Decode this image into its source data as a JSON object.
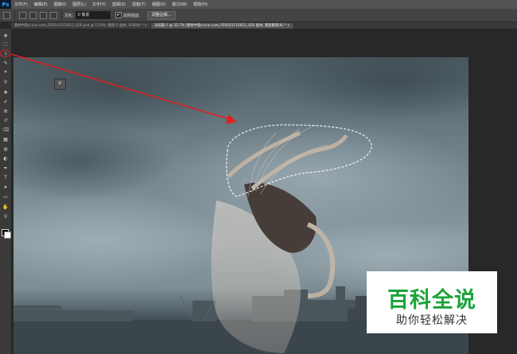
{
  "app": {
    "logo": "Ps"
  },
  "menu": [
    "文件(F)",
    "编辑(E)",
    "图像(I)",
    "图层(L)",
    "文字(Y)",
    "选择(S)",
    "滤镜(T)",
    "视图(V)",
    "窗口(W)",
    "帮助(H)"
  ],
  "options": {
    "feather_label": "羽化:",
    "feather_value": "0 像素",
    "antialias_label": "消除锯齿",
    "antialias_checked": "✔",
    "refine_edge_label": "调整边缘..."
  },
  "tabs": [
    {
      "label": "素材中国sccnn.com_P20161110012_026.psd @ 15.6% (图层 0 副本, RGB/8) *  ×"
    },
    {
      "label": "未标题-1 @ 32.7% (素材中国sccnn.com_P20161110012_026 副本, 图层蒙版/8) *  ×"
    }
  ],
  "toolbar": {
    "tools": [
      "move-tool",
      "marquee-tool",
      "lasso-tool",
      "quick-select-tool",
      "crop-tool",
      "eyedropper-tool",
      "healing-brush-tool",
      "brush-tool",
      "clone-stamp-tool",
      "history-brush-tool",
      "eraser-tool",
      "gradient-tool",
      "blur-tool",
      "dodge-tool",
      "pen-tool",
      "type-tool",
      "path-select-tool",
      "shape-tool",
      "hand-tool",
      "zoom-tool"
    ],
    "glyphs": [
      "✥",
      "⬚",
      "ↄ",
      "✎",
      "⌗",
      "⚲",
      "✚",
      "✐",
      "⚒",
      "↺",
      "⌫",
      "▦",
      "◍",
      "◐",
      "✒",
      "T",
      "➤",
      "▭",
      "✋",
      "⚲"
    ],
    "foreground_color": "#000000",
    "background_color": "#ffffff"
  },
  "canvas": {
    "tooltip_glyph": "P",
    "annotation_color": "#e02020"
  },
  "watermark": {
    "title": "百科全说",
    "subtitle": "助你轻松解决",
    "title_color": "#1aa33a"
  }
}
